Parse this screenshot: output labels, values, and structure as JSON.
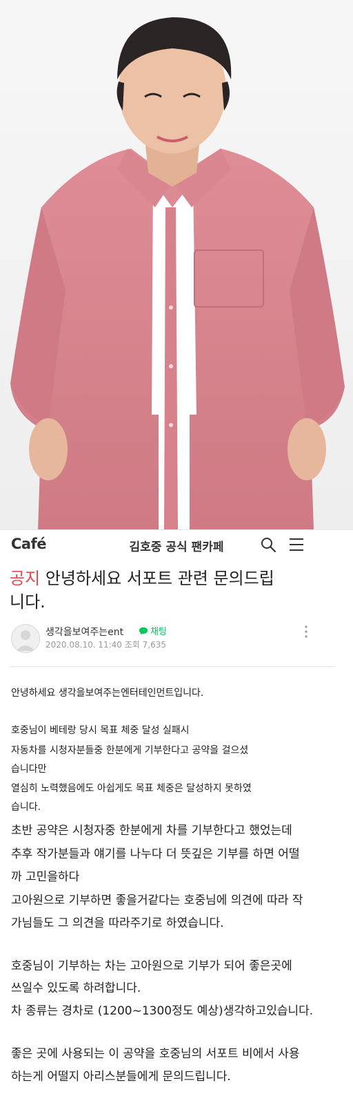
{
  "header": {
    "logo": "Café",
    "title": "김호중 공식 팬카페"
  },
  "post": {
    "notice_tag": "공지",
    "title_line1": "안녕하세요 서포트 관련 문의드립",
    "title_line2": "니다.",
    "author": "생각을보여주는ent",
    "chat_label": "채팅",
    "meta": "2020.08.10. 11:40 조회 7,635"
  },
  "body": {
    "lines": [
      "안녕하세요 생각을보여주는엔터테인먼트입니다.",
      "호중님이 베테랑 당시 목표 체중 달성 실패시",
      "자동차를 시청자분들중 한분에게 기부한다고 공약을 걸으셨",
      "습니다만",
      "열심히 노력했음에도 아쉽게도 목표 체중은 달성하지 못하였",
      "습니다.",
      "초반 공약은 시청자중 한분에게 차를 기부한다고 했었는데",
      "추후 작가분들과 얘기를 나누다 더 뜻깊은 기부를 하면 어떨",
      "까 고민을하다",
      "고아원으로 기부하면 좋을거같다는 호중님에 의견에 따라 작",
      "가님들도 그 의견을 따라주기로 하였습니다.",
      "호중님이 기부하는 차는 고아원으로 기부가 되어 좋은곳에",
      "쓰일수 있도록 하려합니다.",
      "차 종류는 경차로 (1200~1300정도 예상)생각하고있습니다.",
      "좋은 곳에 사용되는 이 공약을 호중님의 서포트 비에서 사용",
      "하는게 어떨지 아리스분들에게 문의드립니다."
    ]
  },
  "colors": {
    "notice": "#e4494d",
    "chat": "#03c75a",
    "shirt": "#d9868f"
  }
}
